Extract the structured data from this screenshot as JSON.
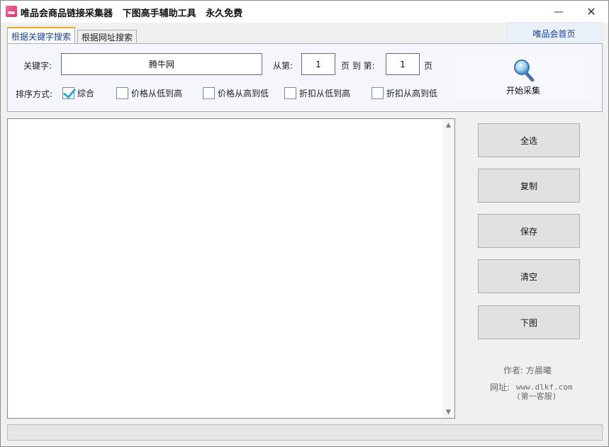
{
  "window": {
    "title": "唯品会商品链接采集器   下图高手辅助工具   永久免费",
    "minimize_glyph": "—",
    "close_glyph": "✕"
  },
  "header": {
    "home_button": "唯品会首页"
  },
  "tabs": [
    {
      "label": "根据关键字搜索",
      "active": true
    },
    {
      "label": "根据网址搜索",
      "active": false
    }
  ],
  "search": {
    "keyword_label": "关键字:",
    "keyword_value": "腾牛网",
    "from_label": "从第:",
    "from_value": "1",
    "to_label": "页 到 第:",
    "to_value": "1",
    "page_suffix": "页",
    "sort_label": "排序方式:",
    "sort_options": [
      {
        "label": "综合",
        "checked": true
      },
      {
        "label": "价格从低到高",
        "checked": false
      },
      {
        "label": "价格从高到低",
        "checked": false
      },
      {
        "label": "折扣从低到高",
        "checked": false
      },
      {
        "label": "折扣从高到低",
        "checked": false
      }
    ],
    "start_button": "开始采集",
    "start_icon": "magnifier-icon"
  },
  "results": {
    "content": ""
  },
  "actions": {
    "select_all": "全选",
    "copy": "复制",
    "save": "保存",
    "clear": "清空",
    "download_images": "下图"
  },
  "info": {
    "author": "作者: 方晨曦",
    "website_label": "网址:",
    "website": "www.dlkf.com",
    "website_note": "(第一客服)"
  },
  "progress": {
    "value": 0
  },
  "colors": {
    "accent_link": "#1a3fa3",
    "tab_highlight": "#f5a623",
    "checkmark": "#2ba9d8"
  }
}
